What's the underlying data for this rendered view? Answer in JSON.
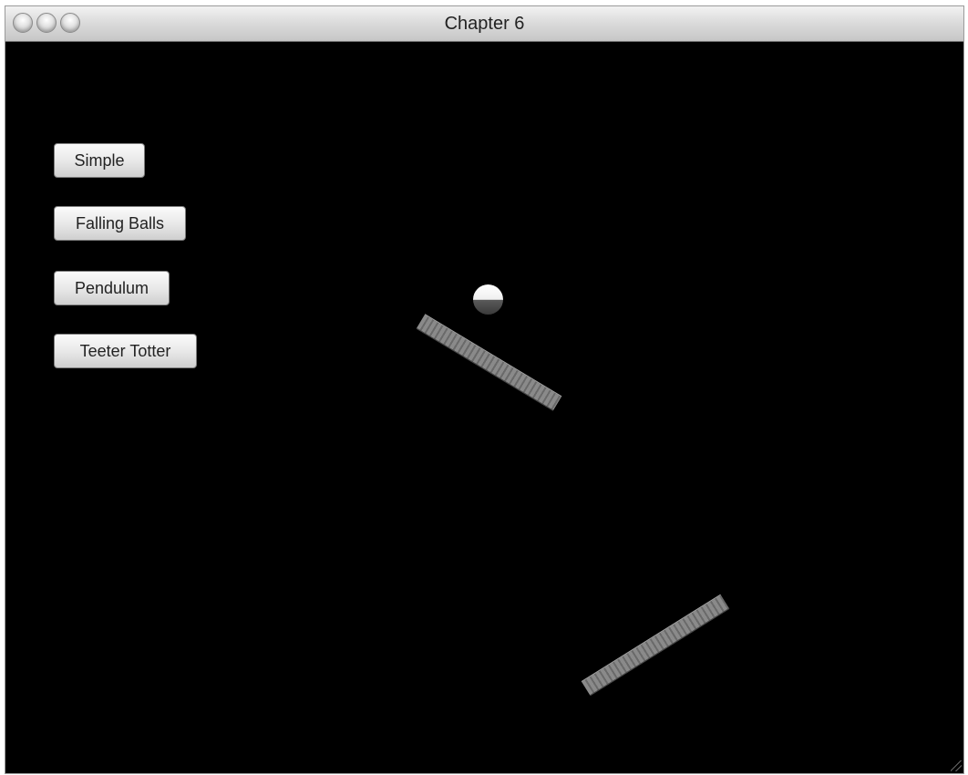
{
  "window": {
    "title": "Chapter 6"
  },
  "titlebar": {
    "buttons": [
      {
        "name": "close-button",
        "icon": "close-icon"
      },
      {
        "name": "minimize-button",
        "icon": "minimize-icon"
      },
      {
        "name": "zoom-button",
        "icon": "zoom-icon"
      }
    ]
  },
  "controls": {
    "buttons": [
      {
        "label": "Simple"
      },
      {
        "label": "Falling Balls"
      },
      {
        "label": "Pendulum"
      },
      {
        "label": "Teeter Totter"
      }
    ]
  },
  "scene": {
    "background": "#000000",
    "objects": [
      "upper-plank",
      "ball",
      "lower-plank"
    ]
  }
}
